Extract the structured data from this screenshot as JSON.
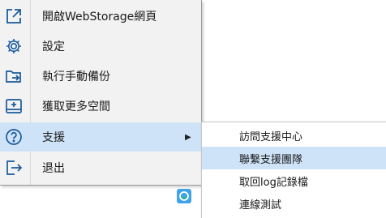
{
  "menu": {
    "items": [
      {
        "label": "開啟WebStorage網頁",
        "icon": "open-external-icon"
      },
      {
        "label": "設定",
        "icon": "gear-icon"
      },
      {
        "label": "執行手動備份",
        "icon": "folder-arrow-icon"
      },
      {
        "label": "獲取更多空間",
        "icon": "storage-add-icon"
      },
      {
        "label": "支援",
        "icon": "help-circle-icon",
        "highlighted": true
      },
      {
        "label": "退出",
        "icon": "exit-icon"
      }
    ],
    "submenu_arrow": "▶"
  },
  "submenu": {
    "items": [
      {
        "label": "訪問支援中心"
      },
      {
        "label": "聯繫支援團隊",
        "highlighted": true
      },
      {
        "label": "取回log記錄檔"
      },
      {
        "label": "連線測試"
      }
    ]
  },
  "colors": {
    "icon_blue": "#1a5a9c",
    "highlight": "#cfe3f8",
    "menu_bg": "#f2f2f2",
    "tray_icon": "#3fa3e7"
  }
}
